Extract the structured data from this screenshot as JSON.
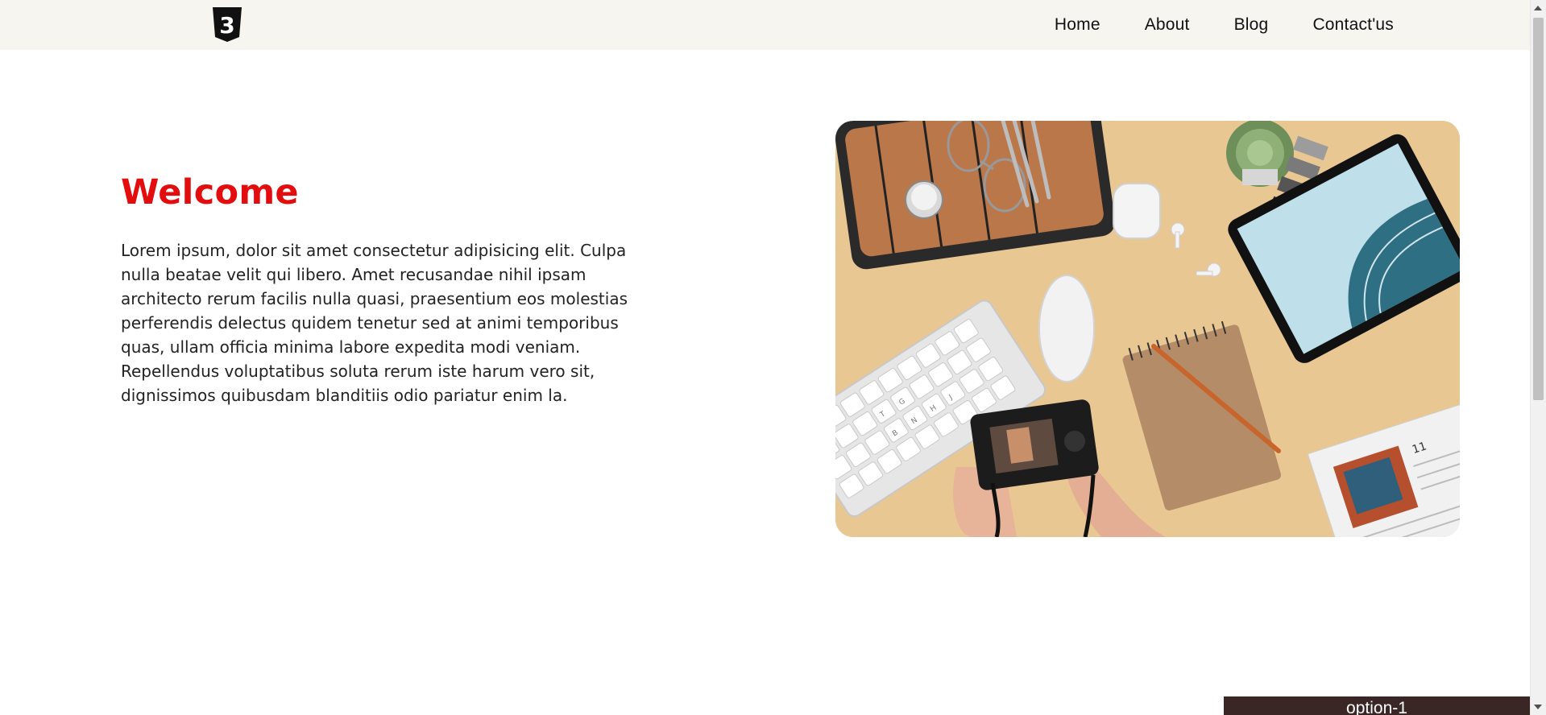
{
  "header": {
    "logo_icon": "css3-shield-icon",
    "logo_text": "3",
    "nav": [
      {
        "label": "Home"
      },
      {
        "label": "About"
      },
      {
        "label": "Blog"
      },
      {
        "label": "Contact'us"
      }
    ]
  },
  "hero": {
    "title": "Welcome",
    "text": "Lorem ipsum, dolor sit amet consectetur adipisicing elit. Culpa nulla beatae velit qui libero. Amet recusandae nihil ipsam architecto rerum facilis nulla quasi, praesentium eos molestias perferendis delectus quidem tenetur sed at animi temporibus quas, ullam officia minima labore expedita modi veniam. Repellendus voluptatibus soluta rerum iste harum vero sit, dignissimos quibusdam blanditiis odio pariatur enim la.",
    "image_icon": "desk-flatlay-photo-icon",
    "image_keyboard_keys": [
      "T",
      "G",
      "B",
      "N",
      "H",
      "J"
    ],
    "image_newspaper_text": "11"
  },
  "footer": {
    "select_value": "option-1"
  },
  "colors": {
    "title_red": "#e30d0d",
    "header_bg": "#f7f5f0",
    "select_bg": "#3b2626",
    "desk_bg": "#e9c792"
  }
}
